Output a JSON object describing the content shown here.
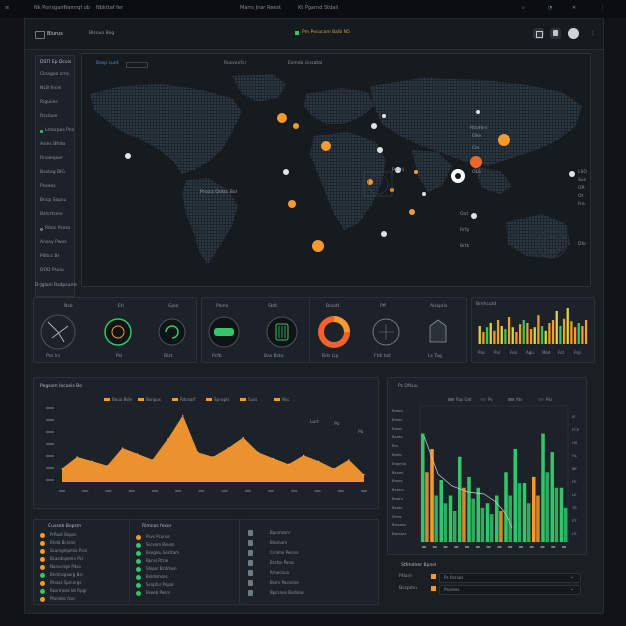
{
  "topbar": {
    "items": [
      "Nk Porisgam",
      "Nsmrqf ob",
      "Nbkttaf fer",
      "Marrs Jnar Reest",
      "Kt Pgarnd Stdaii"
    ]
  },
  "header": {
    "brand": "Blurus",
    "subtitle": "Blsnuo Bog",
    "center_label": "Pm Pecucam Balb N5"
  },
  "sidebar": {
    "title": "DSTI Ep Dcois",
    "items": [
      "Clnagoo crrsi",
      "NLB fecei",
      "Riguiies",
      "Rsslaoe",
      "Lntorpos Pnz",
      "Asies Bfrdo",
      "Rnaleqaer",
      "Bsoteg BIG",
      "Psaeos",
      "Bncp Sopsu",
      "Bsfortsms",
      "Ritoc Psesz",
      "Ansoy Pwos",
      "Pilltcc Br",
      "DOD Psaiu"
    ]
  },
  "map": {
    "tabs": [
      "Basp cunt",
      "Rusvonfcr",
      "Esmnb cinsatal"
    ],
    "caption": "Prsscs Qotsc Bol",
    "region_labels": [
      "Rtiofers",
      "Ohe",
      "Cla",
      "OLS",
      "Ponhi",
      "LSO",
      "Sos",
      "OR",
      "Ot",
      "Fre",
      "Ont",
      "Rrfp",
      "Brtk",
      "Dfo"
    ]
  },
  "status_strip": {
    "label": "D-Jgloni Rsdpsurre"
  },
  "widgets": [
    {
      "labels": [
        "Nsb",
        "Eti",
        "Gjea"
      ],
      "footers": [
        "Pss lrs",
        "Psl",
        "Bist"
      ]
    },
    {
      "labels": [
        "Plono",
        "Sbfc"
      ],
      "footers": [
        "Pcfb",
        "Bas Bsto"
      ]
    },
    {
      "labels": [
        "Boodt",
        "Pff",
        "Alsspris"
      ],
      "footers": [
        "Bds Lip",
        "Ftdi tsit",
        "Ls Tag"
      ]
    }
  ],
  "mini_bars": {
    "label": "Bmhcutd",
    "x_labels": [
      "Pso",
      "Pul",
      "Fea",
      "Agu",
      "Mod",
      "Fot",
      "Fsp"
    ]
  },
  "area_chart": {
    "title": "Pegsom locoeis Bo",
    "legend": [
      "Bouo Bsfe",
      "Bonpus",
      "Rdcoarf",
      "Spnspls",
      "Suss",
      "Nsc"
    ],
    "right_labels": [
      "Lurt",
      "Po",
      "Pa"
    ]
  },
  "right_chart": {
    "title": "Ps Dfkuu",
    "legend": [
      "Ras Gnt",
      "Ps",
      "Ats",
      "Pss"
    ],
    "y_labels": [
      "Brase",
      "Bresc",
      "Bloos",
      "Bsreo",
      "Brs",
      "Beeo",
      "Eepmio",
      "Bsnes",
      "Brsos",
      "Bseno",
      "Bears",
      "Bsser",
      "Sfres",
      "Blrsaes",
      "Barsarz"
    ],
    "footer": "Psr Bdfieoa Bfsnfpx",
    "right_labels": [
      "IE",
      "FCE",
      "HS",
      "HL",
      "8E",
      "FE",
      "LE",
      "TE",
      "ST",
      "LS"
    ]
  },
  "list_left": {
    "title": "Cusseb Bopsm",
    "items": [
      "Prfloot Bopos",
      "Rhdd Bcroisr",
      "Scamgmpmia Pcai",
      "Bcasdnpemn Pcr",
      "Nanvcnge Pdso",
      "Bndmsgaorg Bsr",
      "Pinoss Spinnrgs",
      "Rosrmesa lot Rpgr",
      "Ptondoc fcor"
    ]
  },
  "list_mid": {
    "title": "Rimnas fesor",
    "items": [
      "Psvs Pcurus",
      "Srcvom Biesm",
      "Bsegisu Secitam",
      "Bpnsi Rtcw",
      "Sfopsr Bcdrhen",
      "Boldsmsns",
      "Ssnpfur Pnpar",
      "Bsoeb Pesrs"
    ]
  },
  "list_right": {
    "items": [
      "Bpomosnr",
      "Blssnarn",
      "Crnlmo Peorss",
      "Brsfsn Parss",
      "Rrnecoua",
      "Bsmr Pocrorse",
      "Bpcsnoo Bsdinas"
    ]
  },
  "bottom_right": {
    "title": "Stfmdlrer Bpnel",
    "rows": [
      {
        "label": "Ptlarn",
        "value": "Ps fornios"
      },
      {
        "label": "Bcspmn",
        "value": "Psorees"
      }
    ]
  },
  "colors": {
    "orange": "#f59a2e",
    "green": "#35c46a",
    "yellow": "#d8d840",
    "panel": "#1c2227",
    "bg": "#101418"
  },
  "chart_data": [
    {
      "type": "area",
      "title": "Pegsom locoeis Bo",
      "series": [
        {
          "values": [
            18,
            34,
            28,
            22,
            46,
            38,
            30,
            58,
            90,
            40,
            34,
            46,
            60,
            40,
            32,
            24,
            36,
            28,
            18,
            30,
            10
          ]
        }
      ]
    },
    {
      "type": "bar",
      "title": "Bmhcutd",
      "values": [
        30,
        20,
        28,
        35,
        22,
        40,
        30,
        25,
        45,
        28,
        20,
        33,
        40,
        35,
        25,
        28,
        48,
        30,
        22,
        35,
        40,
        55,
        30,
        42,
        60,
        38,
        28,
        35,
        30,
        40
      ]
    },
    {
      "type": "bar",
      "title": "Ps Dfkuu",
      "series": [
        {
          "values": [
            70,
            60,
            40,
            30,
            55,
            42,
            35,
            25,
            30,
            45,
            60,
            38,
            42,
            70,
            58,
            35
          ]
        },
        {
          "values": [
            45,
            30,
            25,
            20,
            35,
            28,
            22,
            18,
            20,
            30,
            38,
            25,
            30,
            45,
            35,
            22
          ]
        }
      ]
    }
  ]
}
